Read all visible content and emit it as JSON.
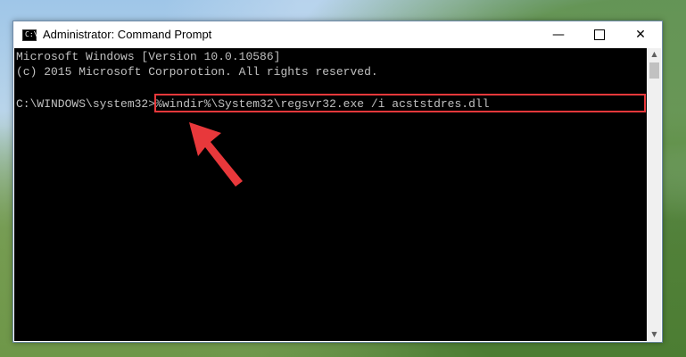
{
  "window": {
    "title": "Administrator: Command Prompt",
    "icon_name": "cmd-icon",
    "icon_text": "C:\\"
  },
  "controls": {
    "minimize": "—",
    "maximize_icon": "maximize-icon",
    "close": "✕"
  },
  "console": {
    "line1": "Microsoft Windows [Version 10.0.10586]",
    "line2": "(c) 2015 Microsoft Corporotion. All rights reserved.",
    "prompt": "C:\\WINDOWS\\system32>",
    "command": "%windir%\\System32\\regsvr32.exe /i acststdres.dll"
  },
  "colors": {
    "highlight_border": "#e8383b",
    "arrow": "#e8383b",
    "console_bg": "#000000",
    "console_fg": "#c0c0c0"
  }
}
